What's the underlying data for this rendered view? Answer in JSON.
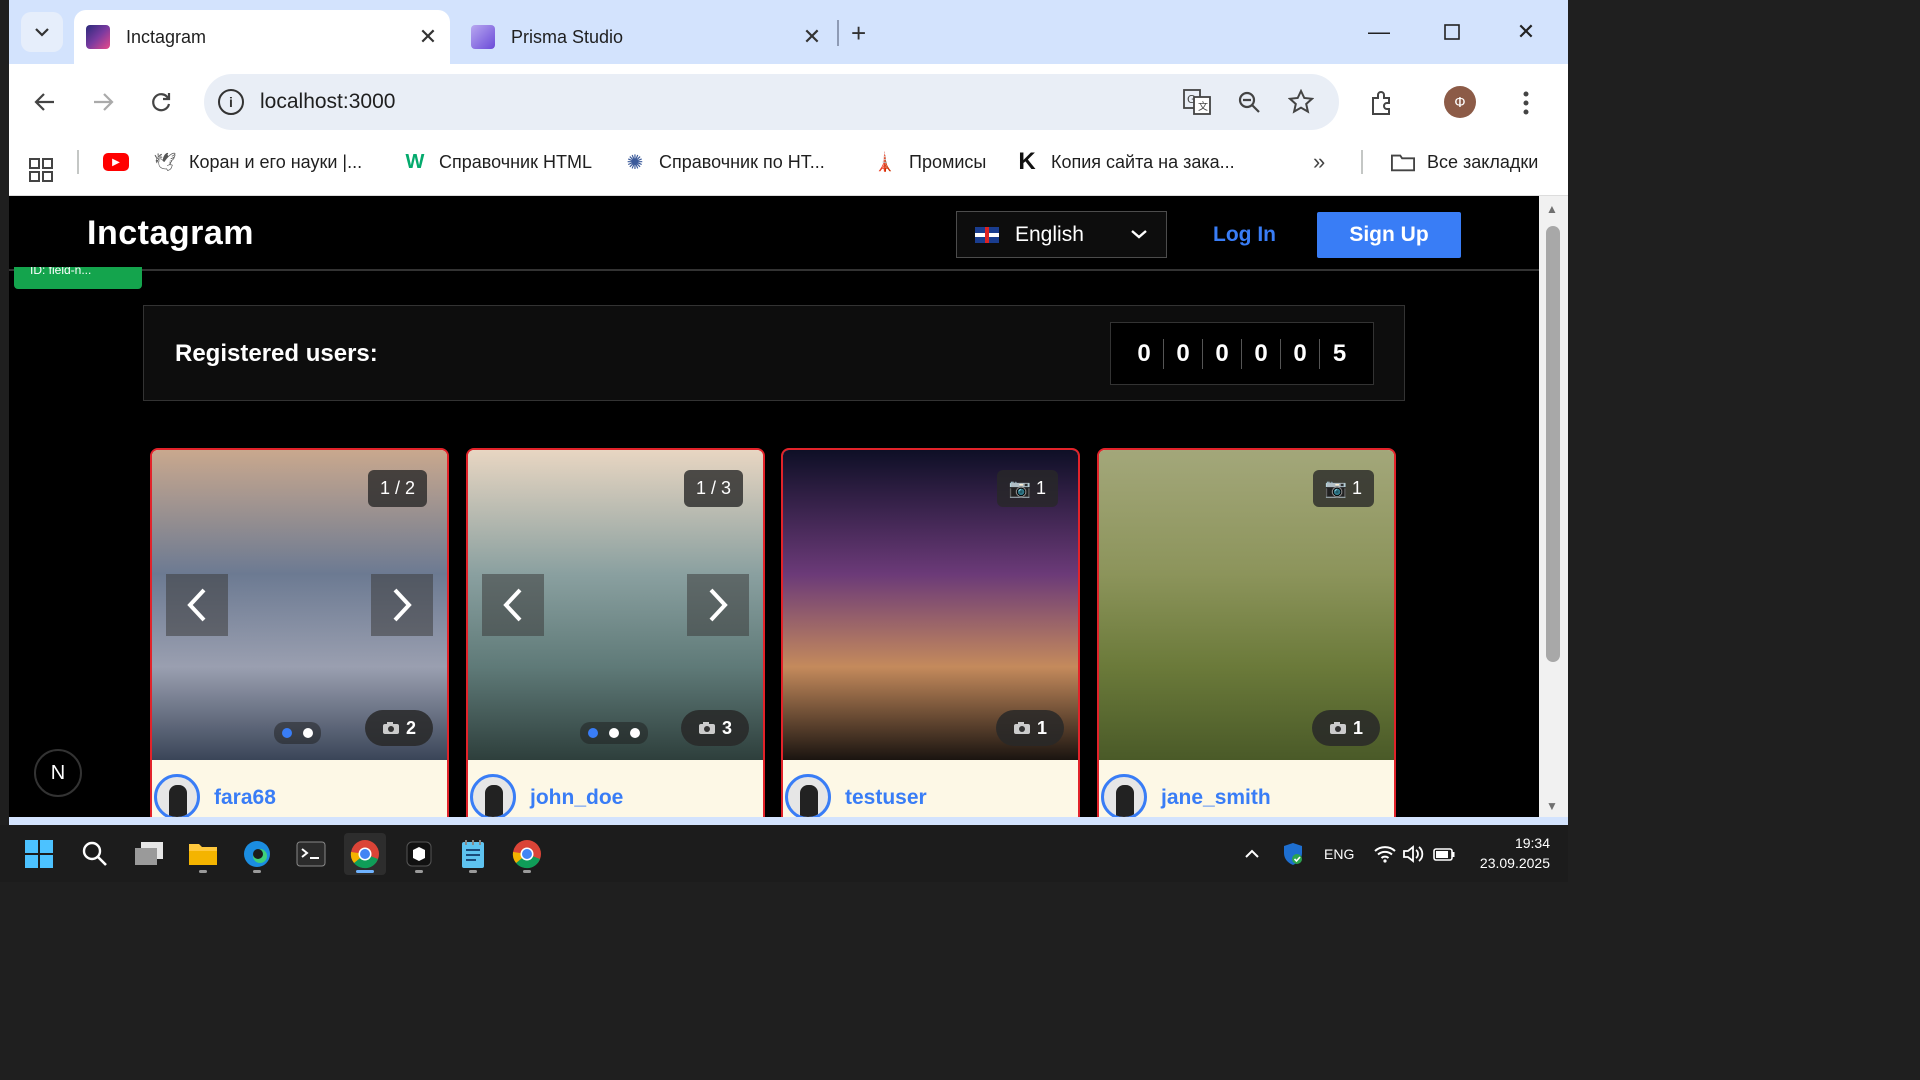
{
  "browser": {
    "tabs": [
      {
        "title": "Inctagram",
        "active": true
      },
      {
        "title": "Prisma Studio",
        "active": false
      }
    ],
    "url": "localhost:3000",
    "profile_initial": "Ф",
    "bookmarks": [
      {
        "label": "",
        "icon": "youtube-icon"
      },
      {
        "label": "Коран и его науки |...",
        "icon": "bird-icon"
      },
      {
        "label": "Справочник HTML",
        "icon": "w3-icon"
      },
      {
        "label": "Справочник по HT...",
        "icon": "wheel-icon"
      },
      {
        "label": "Промисы",
        "icon": "tower-icon"
      },
      {
        "label": "Копия сайта на зака...",
        "icon": "k-icon"
      }
    ],
    "all_bookmarks_label": "Все закладки"
  },
  "site": {
    "logo": "Inctagram",
    "language": "English",
    "login_label": "Log In",
    "signup_label": "Sign Up",
    "dev_badge": "ID: field-n...",
    "registered_label": "Registered users:",
    "counter_digits": [
      "0",
      "0",
      "0",
      "0",
      "0",
      "5"
    ],
    "nextjs_badge": "N"
  },
  "posts": [
    {
      "username": "fara68",
      "page": "1 / 2",
      "photo_count": "2",
      "dots": 2,
      "active_dot": 0,
      "has_nav": true,
      "colors": [
        "#c9a88e",
        "#6c7a92",
        "#9a9fb0",
        "#3a4558"
      ]
    },
    {
      "username": "john_doe",
      "page": "1 / 3",
      "photo_count": "3",
      "dots": 3,
      "active_dot": 0,
      "has_nav": true,
      "colors": [
        "#e8d6c2",
        "#8aa0a0",
        "#5f7a78",
        "#2e3f3c"
      ]
    },
    {
      "username": "testuser",
      "page": "📷 1",
      "photo_count": "1",
      "dots": 0,
      "active_dot": 0,
      "has_nav": false,
      "colors": [
        "#0e0f26",
        "#6b3a78",
        "#c48a5c",
        "#1a1410"
      ]
    },
    {
      "username": "jane_smith",
      "page": "📷 1",
      "photo_count": "1",
      "dots": 0,
      "active_dot": 0,
      "has_nav": false,
      "colors": [
        "#a3a77a",
        "#8c945b",
        "#6b7a3a",
        "#4a5a28"
      ]
    }
  ],
  "taskbar": {
    "lang": "ENG",
    "time": "19:34",
    "date": "23.09.2025"
  }
}
